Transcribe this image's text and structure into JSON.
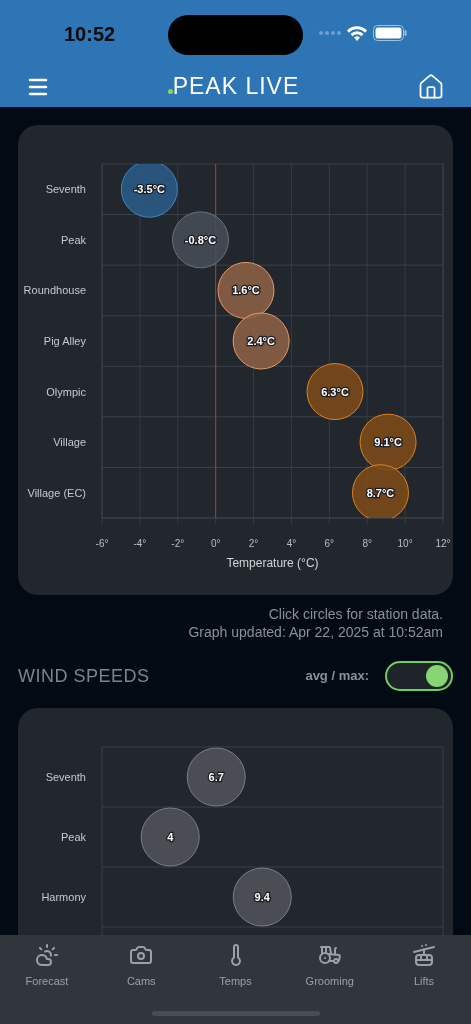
{
  "status_bar": {
    "time": "10:52"
  },
  "header": {
    "title": "PEAK LIVE"
  },
  "temperature_chart": {
    "chart_data": {
      "type": "scatter",
      "orientation": "horizontal",
      "xlabel": "Temperature (°C)",
      "categories": [
        "Seventh",
        "Peak",
        "Roundhouse",
        "Pig Alley",
        "Olympic",
        "Village",
        "Village (EC)"
      ],
      "series": [
        {
          "values": [
            -3.5,
            -0.8,
            1.6,
            2.4,
            6.3,
            9.1,
            8.7
          ]
        }
      ],
      "value_labels": [
        "-3.5°C",
        "-0.8°C",
        "1.6°C",
        "2.4°C",
        "6.3°C",
        "9.1°C",
        "8.7°C"
      ],
      "xlim": [
        -6,
        12
      ],
      "grid": true,
      "ref_lines": [
        {
          "axis": "x",
          "value": 0,
          "color": "#b8332c"
        }
      ],
      "xticks": [
        {
          "value": -6,
          "label": "-6°"
        },
        {
          "value": -4,
          "label": "-4°"
        },
        {
          "value": -2,
          "label": "-2°"
        },
        {
          "value": 0,
          "label": "0°"
        },
        {
          "value": 2,
          "label": "2°"
        },
        {
          "value": 4,
          "label": "4°"
        },
        {
          "value": 6,
          "label": "6°"
        },
        {
          "value": 8,
          "label": "8°"
        },
        {
          "value": 10,
          "label": "10°"
        },
        {
          "value": 12,
          "label": "12°"
        }
      ]
    }
  },
  "chart_note": "Click circles for station data.",
  "updated": "Graph updated: Apr 22, 2025 at 10:52am",
  "wind_section": {
    "title": "WIND SPEEDS",
    "toggle": {
      "label": "avg / max:",
      "on": true
    }
  },
  "wind_chart": {
    "chart_data": {
      "type": "scatter",
      "orientation": "horizontal",
      "categories": [
        "Seventh",
        "Peak",
        "Harmony"
      ],
      "series": [
        {
          "values": [
            6.7,
            4,
            9.4
          ]
        }
      ],
      "data_labels": true,
      "xlim": [
        0,
        20
      ]
    }
  },
  "tab_bar": [
    {
      "label": "Forecast",
      "kind": "forecast"
    },
    {
      "label": "Cams",
      "kind": "cams"
    },
    {
      "label": "Temps",
      "kind": "temps"
    },
    {
      "label": "Grooming",
      "kind": "grooming"
    },
    {
      "label": "Lifts",
      "kind": "lifts"
    }
  ]
}
